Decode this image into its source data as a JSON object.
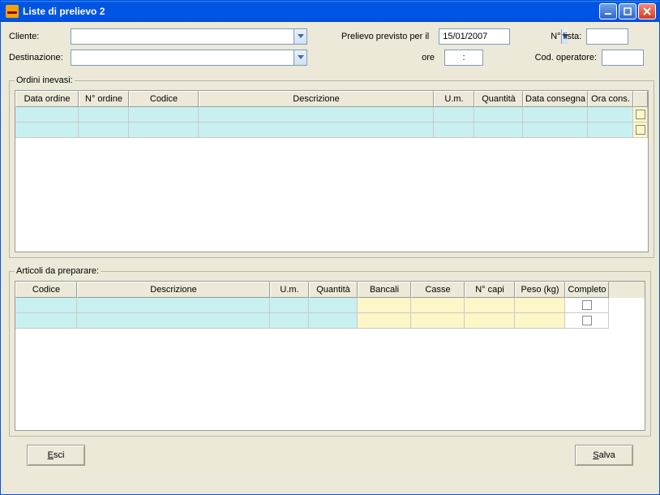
{
  "window": {
    "title": "Liste di prelievo 2"
  },
  "form": {
    "cliente_label": "Cliente:",
    "cliente_value": "",
    "destinazione_label": "Destinazione:",
    "destinazione_value": "",
    "prelievo_label": "Prelievo previsto per il",
    "prelievo_date": "15/01/2007",
    "ore_label": "ore",
    "ore_value": ":",
    "nlista_label": "N° lista:",
    "nlista_value": "",
    "codop_label": "Cod. operatore:",
    "codop_value": ""
  },
  "grid1": {
    "legend": "Ordini inevasi:",
    "headers": {
      "c0": "Data ordine",
      "c1": "N° ordine",
      "c2": "Codice",
      "c3": "Descrizione",
      "c4": "U.m.",
      "c5": "Quantità",
      "c6": "Data consegna",
      "c7": "Ora cons."
    }
  },
  "grid2": {
    "legend": "Articoli da preparare:",
    "headers": {
      "c0": "Codice",
      "c1": "Descrizione",
      "c2": "U.m.",
      "c3": "Quantità",
      "c4": "Bancali",
      "c5": "Casse",
      "c6": "N° capi",
      "c7": "Peso (kg)",
      "c8": "Completo"
    }
  },
  "buttons": {
    "esci": "Esci",
    "salva": "Salva"
  }
}
